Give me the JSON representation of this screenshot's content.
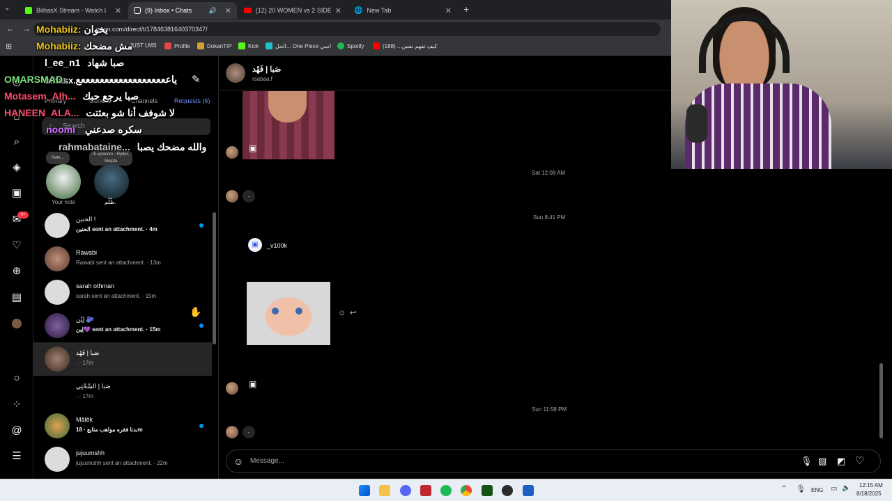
{
  "browser": {
    "tabs": [
      {
        "label": "BiihasX Stream - Watch Live on",
        "active": false
      },
      {
        "label": "(9) Inbox • Chats",
        "active": true
      },
      {
        "label": "(12) 20 WOMEN vs 2 SIDEMEN",
        "active": false
      },
      {
        "label": "New Tab",
        "active": false
      }
    ],
    "url": "gram.com/direct/t/17846381640370347/",
    "bookmarks": [
      "JUST LMS",
      "Profile",
      "DokanTIP",
      "Kick",
      "الحل... One Piece انمي",
      "Spotify",
      "كيف تفهم نفس... (188)"
    ]
  },
  "sidebar": {
    "account": "bihasx.",
    "tabs": [
      "Primary",
      "General",
      "Channels",
      "Requests (6)"
    ],
    "search_placeholder": "Search",
    "notes": [
      {
        "bubble": "Note...",
        "label": "Your note"
      },
      {
        "bubble": "Ill ⌕ptacore ◦ Ryder, Skepta",
        "label": "ظُلْم."
      }
    ],
    "chats": [
      {
        "name": "الحنين !",
        "preview": "الحنين sent an attachment. · 4m",
        "unread": true
      },
      {
        "name": "Rawabi",
        "preview": "Rawabi sent an attachment. · 13m",
        "unread": false
      },
      {
        "name": "sarah othman",
        "preview": "sarah sent an attachment. · 15m",
        "unread": false
      },
      {
        "name": "لِيْن 🫐",
        "preview": "لِين💜 sent an attachment. · 15m",
        "unread": true
      },
      {
        "name": "صَبا | فَهْد",
        "preview": ". · 17m",
        "unread": false
      },
      {
        "name": "صَبا | السَّحْتِي",
        "preview": ". · 17m",
        "unread": false
      },
      {
        "name": "Mālēk",
        "preview": "بدنا فقره مواهب متابع · 18m",
        "unread": true
      },
      {
        "name": "jujuumshh",
        "preview": "jujuumshh sent an attachment. · 22m",
        "unread": false
      }
    ]
  },
  "conversation": {
    "name": "صَبا | فَهْد",
    "handle": "rsabaa.f",
    "timestamps": [
      "Sat 12:08 AM",
      "Sun 8:41 PM",
      "Sun 11:58 PM"
    ],
    "shared_user": "_v100k",
    "dot_message": ".",
    "composer_placeholder": "Message..."
  },
  "taskbar": {
    "lang": "ENG",
    "time": "12:15 AM",
    "date": "8/18/2025"
  },
  "stream_chat": [
    {
      "user": "Mohabiiz:",
      "text": "يخوان",
      "color": "#f0c419"
    },
    {
      "user": "Mohabiiz:",
      "text": "مش مضحك",
      "color": "#f0c419"
    },
    {
      "user": "l_ee_n1",
      "text": "صبا شهاد",
      "color": "#ffffff"
    },
    {
      "user": "OMARSMAD:",
      "text": "ياعععععععععععععععععععع",
      "color": "#7fe07f"
    },
    {
      "user": "Motasem_Alh...",
      "text": "صبا يرجع حبك",
      "color": "#ff4d6d"
    },
    {
      "user": "HANEEN_ALA...",
      "text": "لا شوفف أنا شو بعثتت",
      "color": "#ff4d6d"
    },
    {
      "user": "noomi",
      "text": "سكره صدعني",
      "color": "#d070ff"
    },
    {
      "user": "rahmabataine...",
      "text": "والله مضحك يصبا",
      "color": "#c8c8c8"
    }
  ]
}
